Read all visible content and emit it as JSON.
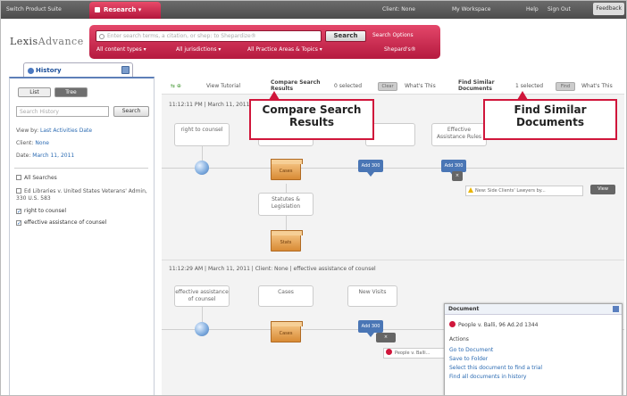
{
  "topbar": {
    "switch_label": "Switch Product Suite",
    "research_tab": "Research",
    "client": "Client: None",
    "my_workspace": "My Workspace",
    "help": "Help",
    "sign_out": "Sign Out",
    "feedback": "Feedback"
  },
  "logo": {
    "brand": "Lexis",
    "product": "Advance"
  },
  "search": {
    "placeholder": "Enter search terms, a citation, or shep: to Shepardize®",
    "button": "Search",
    "options": "Search Options",
    "filters": [
      "All content types ▾",
      "All jurisdictions ▾",
      "All Practice Areas & Topics ▾"
    ],
    "shepardize": "Shepard's®"
  },
  "history": {
    "tab_label": "History",
    "list_btn": "List",
    "tree_btn": "Tree",
    "filter_placeholder": "Search History",
    "filter_btn": "Search",
    "view_by_label": "View by:",
    "view_by_value": "Last Activities Date",
    "client_label": "Client:",
    "client_value": "None",
    "date_label": "Date:",
    "date_value": "March 11, 2011",
    "all_searches": "All Searches",
    "items": [
      {
        "text": "Ed Libraries v. United States Veterans' Admin, 330 U.S. 583",
        "checked": false
      },
      {
        "text": "right to counsel",
        "checked": true
      },
      {
        "text": "effective assistance of counsel",
        "checked": true
      }
    ]
  },
  "toolbar": {
    "view_tutorial": "View Tutorial",
    "compare_label": "Compare Search Results",
    "selected_1": "0 selected",
    "compare_btn": "Clear",
    "whats_this_1": "What's This",
    "find_similar": "Find Similar Documents",
    "selected_2": "1 selected",
    "find_btn": "Find",
    "whats_this_2": "What's This"
  },
  "timeline1": {
    "header": "11:12:11 PM | March 11, 2011",
    "query_card": "right to counsel",
    "card2": "",
    "card3": "Effective Assistance Rules",
    "box1": "Cases",
    "badge1": "Add 300",
    "badge2": "Add 300",
    "stat_card": "Statutes & Legislation",
    "box2": "Stats",
    "note": "New: Side Clients' Lawyers by...",
    "note_btn": "View"
  },
  "timeline2": {
    "header": "11:12:29 AM | March 11, 2011 | Client: None | effective assistance of counsel",
    "query_card": "effective assistance of counsel",
    "cases_card": "Cases",
    "news_card": "New Visits",
    "box": "Cases",
    "badge": "Add 300",
    "doc_label": "People v. Balli..."
  },
  "callouts": {
    "compare": "Compare Search Results",
    "find_similar": "Find Similar Documents"
  },
  "doc_popup": {
    "title": "Document",
    "doc": "People v. Balli, 96 Ad.2d 1344",
    "actions_label": "Actions",
    "actions": [
      "Go to Document",
      "Save to Folder",
      "Select this document to find a trial",
      "Find all documents in history"
    ]
  },
  "colors": {
    "brand": "#c8183f",
    "topbar": "#555555",
    "link": "#2a6ab2"
  }
}
